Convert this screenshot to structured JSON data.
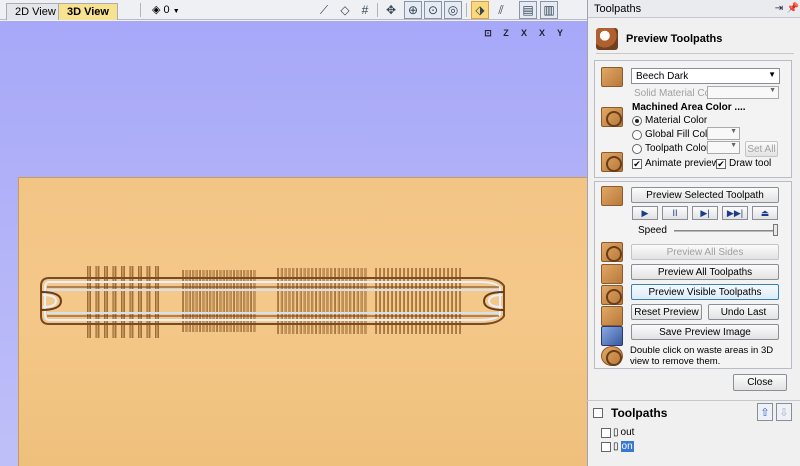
{
  "toolbar": {
    "tabs": [
      "2D View",
      "3D View"
    ],
    "layer_value": "0",
    "icons": [
      "line-tool-icon",
      "shape-tool-icon",
      "grid-icon",
      "move-icon",
      "zoom-selection-icon",
      "zoom-fit-icon",
      "zoom-all-icon",
      "view-toolpaths-icon",
      "material-icon",
      "split-view-horizontal-icon",
      "split-view-vertical-icon"
    ]
  },
  "view": {
    "axis_buttons": [
      "⊡",
      "Z",
      "X",
      "X",
      "Y"
    ],
    "colors": {
      "background": "#b6b6f8",
      "material": "#f2c585"
    }
  },
  "panel": {
    "header": "Toolpaths",
    "title": "Preview Toolpaths",
    "material": {
      "selected": "Beech Dark",
      "solid_color_label": "Solid Material Color",
      "machined_area_label": "Machined Area Color ....",
      "options": [
        "Material Color",
        "Global Fill Color",
        "Toolpath Color"
      ],
      "set_all": "Set All",
      "animate_label": "Animate preview",
      "draw_tool_label": "Draw tool"
    },
    "controls": {
      "preview_selected": "Preview Selected Toolpath",
      "playback": [
        "▶",
        "II",
        "▶|",
        "▶▶|",
        "⏏"
      ],
      "speed_label": "Speed",
      "speed_value": 1.0,
      "preview_all_sides": "Preview All Sides",
      "preview_all_toolpaths": "Preview All Toolpaths",
      "preview_visible": "Preview Visible Toolpaths",
      "reset_preview": "Reset Preview",
      "undo_last": "Undo Last",
      "save_image": "Save Preview Image",
      "hint": "Double click on waste areas in 3D view to remove them."
    },
    "close": "Close",
    "toolpaths": {
      "title": "Toolpaths",
      "items": [
        "out",
        "on"
      ]
    }
  }
}
